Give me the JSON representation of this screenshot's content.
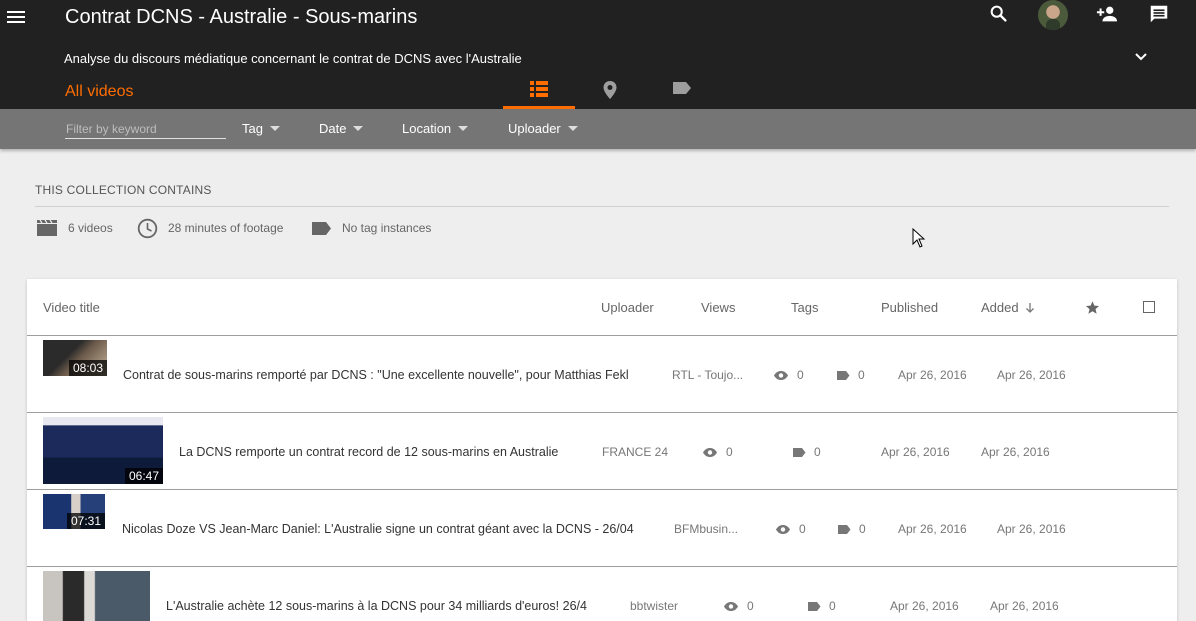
{
  "header": {
    "title": "Contrat DCNS - Australie - Sous-marins",
    "subtitle": "Analyse du discours médiatique concernant le contrat de DCNS avec l'Australie",
    "all_videos_label": "All videos"
  },
  "filters": {
    "keyword_placeholder": "Filter by keyword",
    "tag_label": "Tag",
    "date_label": "Date",
    "location_label": "Location",
    "uploader_label": "Uploader"
  },
  "summary": {
    "heading": "THIS COLLECTION CONTAINS",
    "videos": "6 videos",
    "footage": "28 minutes of footage",
    "tags": "No tag instances"
  },
  "table": {
    "columns": {
      "title": "Video title",
      "uploader": "Uploader",
      "views": "Views",
      "tags": "Tags",
      "published": "Published",
      "added": "Added"
    },
    "rows": [
      {
        "duration": "08:03",
        "title": "Contrat de sous-marins remporté par DCNS : \"Une excellente nouvelle\", pour Matthias Fekl",
        "uploader": "RTL - Toujo...",
        "views": "0",
        "tags": "0",
        "published": "Apr 26, 2016",
        "added": "Apr 26, 2016"
      },
      {
        "duration": "06:47",
        "title": "La DCNS remporte un contrat record de 12 sous-marins en Australie",
        "uploader": "FRANCE 24",
        "views": "0",
        "tags": "0",
        "published": "Apr 26, 2016",
        "added": "Apr 26, 2016"
      },
      {
        "duration": "07:31",
        "title": "Nicolas Doze VS Jean-Marc Daniel: L'Australie signe un contrat géant avec la DCNS - 26/04",
        "uploader": "BFMbusin...",
        "views": "0",
        "tags": "0",
        "published": "Apr 26, 2016",
        "added": "Apr 26, 2016"
      },
      {
        "duration": "",
        "title": "L'Australie achète 12 sous-marins à la DCNS pour 34 milliards d'euros! 26/4",
        "uploader": "bbtwister",
        "views": "0",
        "tags": "0",
        "published": "Apr 26, 2016",
        "added": "Apr 26, 2016"
      }
    ]
  },
  "colors": {
    "accent": "#ff6d00",
    "header_bg": "#212121",
    "filter_bg": "#757575"
  },
  "icons": [
    "menu-icon",
    "search-icon",
    "add-person-icon",
    "comment-icon",
    "chevron-down-icon",
    "list-icon",
    "location-pin-icon",
    "tag-icon",
    "film-icon",
    "clock-icon",
    "eye-icon",
    "star-icon",
    "checkbox-icon"
  ]
}
